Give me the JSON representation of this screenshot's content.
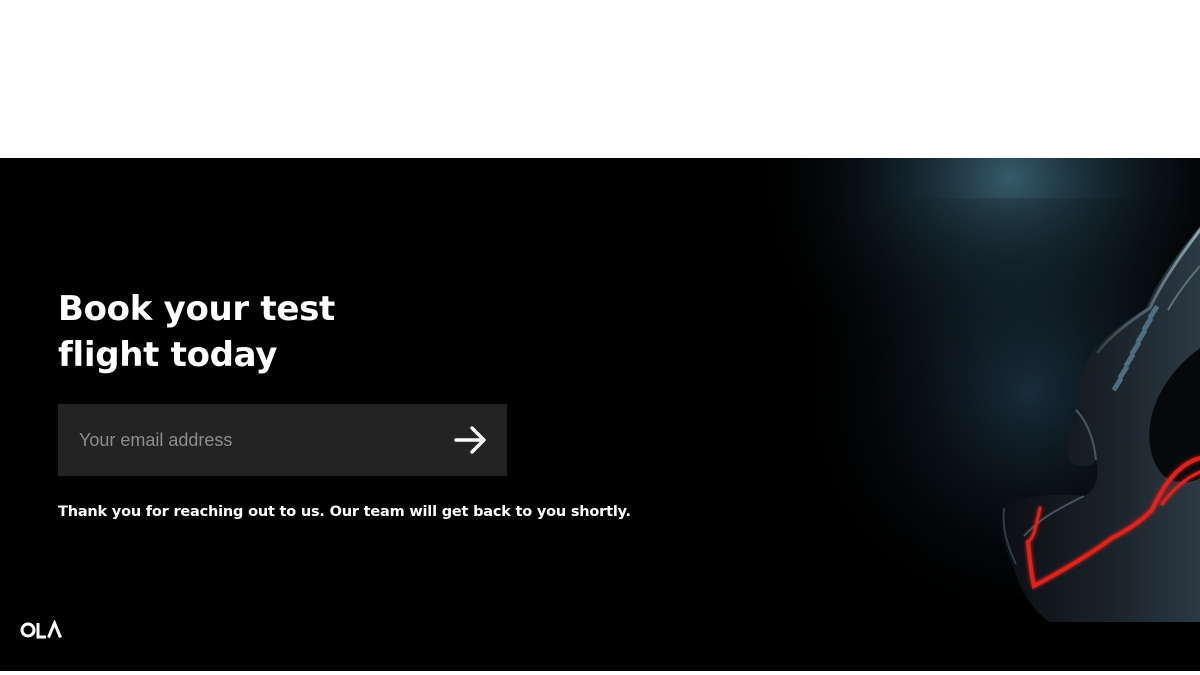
{
  "hero": {
    "headline_line1": "Book your test",
    "headline_line2": "flight today",
    "email_placeholder": "Your email address",
    "email_value": "",
    "submit_icon": "arrow-right-icon",
    "confirmation": "Thank you for reaching out to us. Our team will get back to you shortly."
  },
  "brand": {
    "logo_text": "OLA",
    "background_color": "#000000",
    "input_background": "#232323",
    "accent_color": "#e0241d",
    "glow_color": "#2a4a5c"
  }
}
